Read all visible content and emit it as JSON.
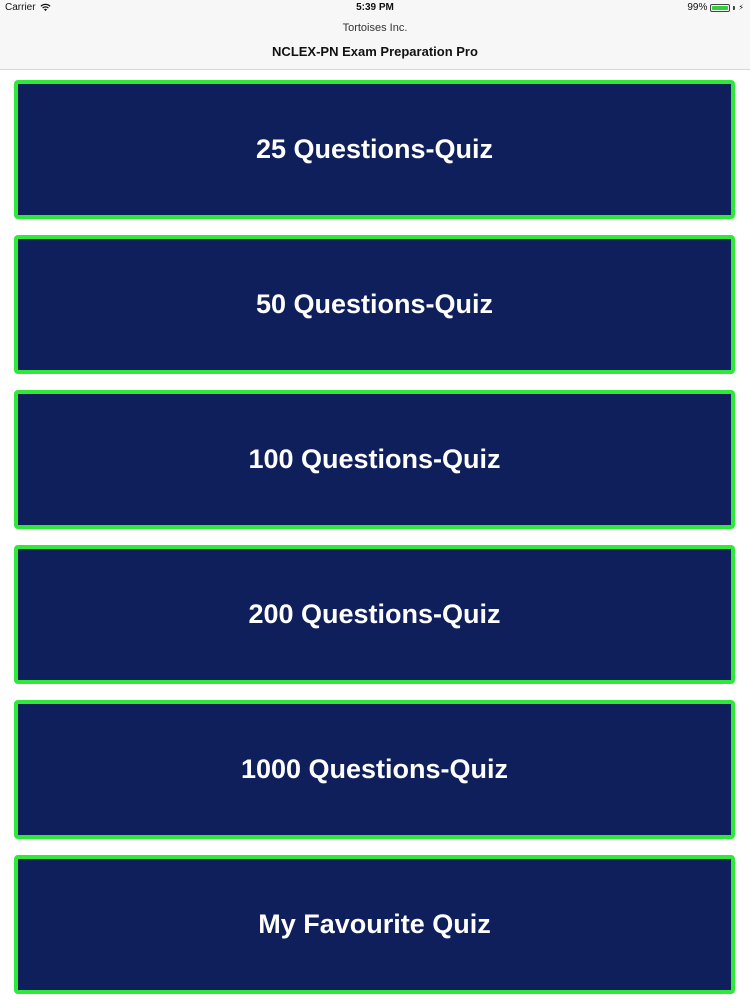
{
  "status_bar": {
    "carrier": "Carrier",
    "time": "5:39 PM",
    "battery_percent": "99%",
    "battery_level": 0.99,
    "wifi_icon": "wifi-icon",
    "battery_icon": "battery-icon",
    "charge_icon": "charge-icon"
  },
  "header": {
    "company": "Tortoises Inc.",
    "title": "NCLEX-PN Exam Preparation Pro"
  },
  "quiz_menu": {
    "items": [
      {
        "label": "25 Questions-Quiz"
      },
      {
        "label": "50 Questions-Quiz"
      },
      {
        "label": "100 Questions-Quiz"
      },
      {
        "label": "200 Questions-Quiz"
      },
      {
        "label": "1000 Questions-Quiz"
      },
      {
        "label": "My Favourite Quiz"
      }
    ]
  },
  "colors": {
    "button_background": "#0f1f5c",
    "button_border": "#2ee83a",
    "button_text": "#ffffff",
    "header_background": "#f7f7f7",
    "battery_fill": "#2fd13a"
  }
}
